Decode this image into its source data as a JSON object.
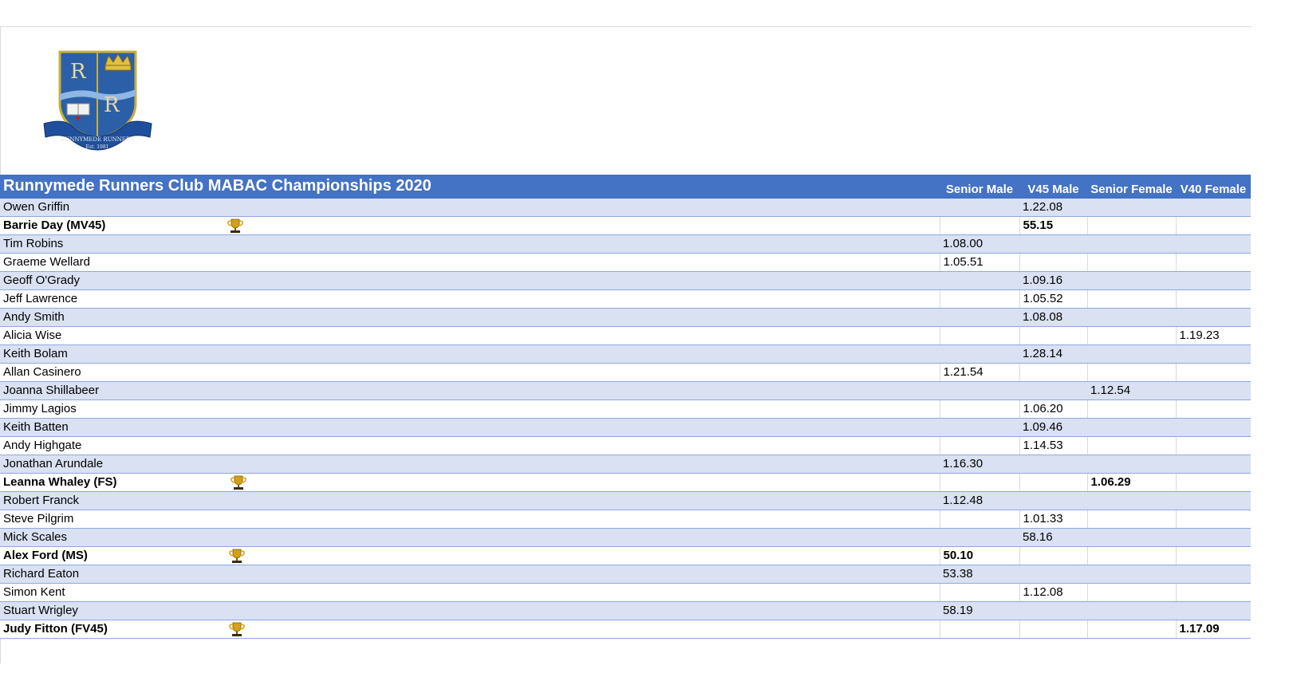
{
  "logo": {
    "top_letters": "R",
    "bottom_letter": "R",
    "banner_text": "RUNNYMEDE RUNNERS",
    "est_text": "Est. 1981"
  },
  "table": {
    "title": "Runnymede Runners Club MABAC Championships 2020",
    "columns": [
      "Senior Male",
      "V45 Male",
      "Senior Female",
      "V40 Female"
    ],
    "rows": [
      {
        "name": "Owen Griffin",
        "trophy": false,
        "bold": false,
        "times": [
          "",
          "1.22.08",
          "",
          ""
        ]
      },
      {
        "name": "Barrie Day (MV45)",
        "trophy": true,
        "bold": true,
        "times": [
          "",
          "55.15",
          "",
          ""
        ]
      },
      {
        "name": "Tim Robins",
        "trophy": false,
        "bold": false,
        "times": [
          "1.08.00",
          "",
          "",
          ""
        ]
      },
      {
        "name": "Graeme Wellard",
        "trophy": false,
        "bold": false,
        "times": [
          "1.05.51",
          "",
          "",
          ""
        ]
      },
      {
        "name": "Geoff O'Grady",
        "trophy": false,
        "bold": false,
        "times": [
          "",
          "1.09.16",
          "",
          ""
        ]
      },
      {
        "name": "Jeff Lawrence",
        "trophy": false,
        "bold": false,
        "times": [
          "",
          "1.05.52",
          "",
          ""
        ]
      },
      {
        "name": "Andy Smith",
        "trophy": false,
        "bold": false,
        "times": [
          "",
          "1.08.08",
          "",
          ""
        ]
      },
      {
        "name": "Alicia Wise",
        "trophy": false,
        "bold": false,
        "times": [
          "",
          "",
          "",
          "1.19.23"
        ]
      },
      {
        "name": "Keith Bolam",
        "trophy": false,
        "bold": false,
        "times": [
          "",
          "1.28.14",
          "",
          ""
        ]
      },
      {
        "name": "Allan Casinero",
        "trophy": false,
        "bold": false,
        "times": [
          "1.21.54",
          "",
          "",
          ""
        ]
      },
      {
        "name": "Joanna Shillabeer",
        "trophy": false,
        "bold": false,
        "times": [
          "",
          "",
          "1.12.54",
          ""
        ]
      },
      {
        "name": "Jimmy Lagios",
        "trophy": false,
        "bold": false,
        "times": [
          "",
          "1.06.20",
          "",
          ""
        ]
      },
      {
        "name": "Keith Batten",
        "trophy": false,
        "bold": false,
        "times": [
          "",
          "1.09.46",
          "",
          ""
        ]
      },
      {
        "name": "Andy Highgate",
        "trophy": false,
        "bold": false,
        "times": [
          "",
          "1.14.53",
          "",
          ""
        ]
      },
      {
        "name": "Jonathan Arundale",
        "trophy": false,
        "bold": false,
        "times": [
          "1.16.30",
          "",
          "",
          ""
        ]
      },
      {
        "name": "Leanna Whaley (FS)",
        "trophy": true,
        "bold": true,
        "times": [
          "",
          "",
          "1.06.29",
          ""
        ]
      },
      {
        "name": "Robert Franck",
        "trophy": false,
        "bold": false,
        "times": [
          "1.12.48",
          "",
          "",
          ""
        ]
      },
      {
        "name": "Steve Pilgrim",
        "trophy": false,
        "bold": false,
        "times": [
          "",
          "1.01.33",
          "",
          ""
        ]
      },
      {
        "name": "Mick Scales",
        "trophy": false,
        "bold": false,
        "times": [
          "",
          "58.16",
          "",
          ""
        ]
      },
      {
        "name": "Alex Ford (MS)",
        "trophy": true,
        "bold": true,
        "times": [
          "50.10",
          "",
          "",
          ""
        ]
      },
      {
        "name": "Richard Eaton",
        "trophy": false,
        "bold": false,
        "times": [
          "53.38",
          "",
          "",
          ""
        ]
      },
      {
        "name": "Simon Kent",
        "trophy": false,
        "bold": false,
        "times": [
          "",
          "1.12.08",
          "",
          ""
        ]
      },
      {
        "name": "Stuart Wrigley",
        "trophy": false,
        "bold": false,
        "times": [
          "58.19",
          "",
          "",
          ""
        ]
      },
      {
        "name": "Judy Fitton (FV45)",
        "trophy": true,
        "bold": true,
        "times": [
          "",
          "",
          "",
          "1.17.09"
        ]
      }
    ]
  },
  "colors": {
    "header_bg": "#4472c4",
    "band_bg": "#d9e1f2",
    "row_border": "#8ea9db",
    "trophy_gold": "#d4a017"
  }
}
